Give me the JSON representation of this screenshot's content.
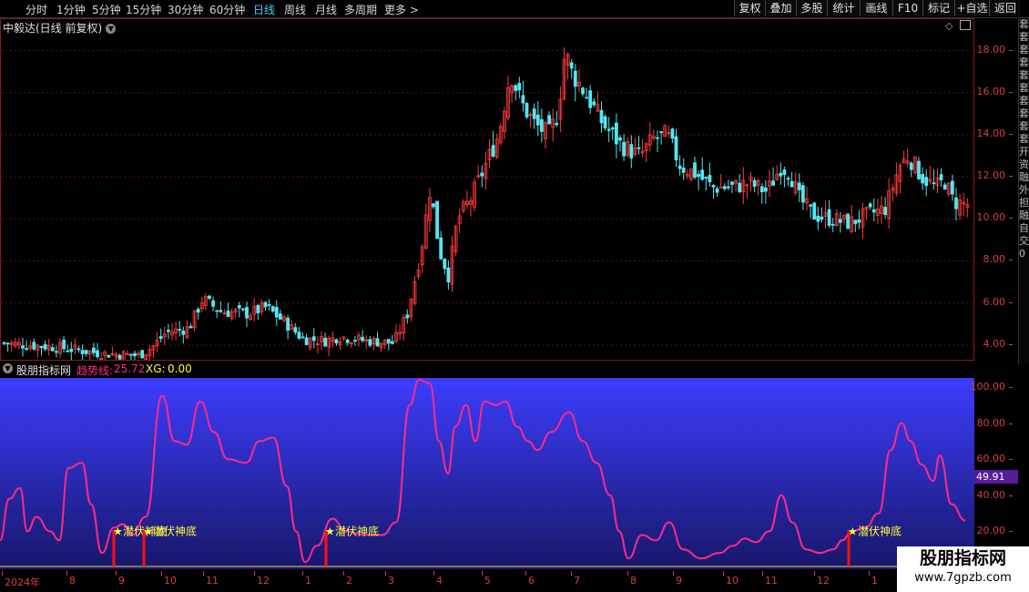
{
  "toolbar": {
    "tabs": [
      "分时",
      "1分钟",
      "5分钟",
      "15分钟",
      "30分钟",
      "60分钟",
      "日线",
      "周线",
      "月线",
      "多周期",
      "更多 >"
    ],
    "active_tab": "日线",
    "buttons": [
      "复权",
      "叠加",
      "多股",
      "统计",
      "画线",
      "F10",
      "标记",
      "+自选",
      "返回"
    ]
  },
  "stock": {
    "title": "中毅达(日线 前复权)"
  },
  "indicator": {
    "name": "股朋指标网",
    "trend_label": "趋势线:",
    "trend_value": "25.72",
    "xg_label": "XG:",
    "xg_value": "0.00",
    "current_value": "49.91",
    "signal_text": "潜伏神底"
  },
  "side_text": "套 套 套 套 套 套 套 套 套 套 开 资 融 外 担 融 自 交 0",
  "watermark": {
    "line1": "股朋指标网",
    "line2": "www.7gpzb.com"
  },
  "colors": {
    "up": "#ff3b3b",
    "down": "#54e6f0",
    "trend": "#ff2a88",
    "panel_top": "#3d3dff",
    "panel_bottom": "#17176a"
  },
  "chart_data": [
    {
      "type": "candlestick",
      "price_ticks": [
        "18.00",
        "16.00",
        "14.00",
        "12.00",
        "10.00",
        "8.00",
        "6.00",
        "4.00"
      ],
      "ylim": [
        3.3,
        19.5
      ],
      "close_points": [
        [
          0,
          4.1
        ],
        [
          60,
          3.9
        ],
        [
          110,
          3.6
        ],
        [
          150,
          3.5
        ],
        [
          165,
          3.9
        ],
        [
          180,
          4.6
        ],
        [
          205,
          4.8
        ],
        [
          220,
          6.2
        ],
        [
          240,
          5.6
        ],
        [
          270,
          5.5
        ],
        [
          290,
          5.8
        ],
        [
          310,
          5.1
        ],
        [
          330,
          4.3
        ],
        [
          355,
          4.2
        ],
        [
          370,
          4.4
        ],
        [
          400,
          4.2
        ],
        [
          430,
          4.1
        ],
        [
          445,
          5.5
        ],
        [
          460,
          8.5
        ],
        [
          470,
          11.5
        ],
        [
          480,
          8.5
        ],
        [
          490,
          7.3
        ],
        [
          500,
          10.0
        ],
        [
          515,
          11.0
        ],
        [
          530,
          12.5
        ],
        [
          545,
          14.0
        ],
        [
          558,
          17.0
        ],
        [
          570,
          15.5
        ],
        [
          585,
          14.5
        ],
        [
          600,
          14.0
        ],
        [
          610,
          15.0
        ],
        [
          618,
          18.0
        ],
        [
          625,
          17.0
        ],
        [
          640,
          16.0
        ],
        [
          660,
          14.5
        ],
        [
          680,
          13.5
        ],
        [
          700,
          13.0
        ],
        [
          715,
          13.8
        ],
        [
          730,
          14.0
        ],
        [
          745,
          12.5
        ],
        [
          760,
          12.2
        ],
        [
          780,
          11.5
        ],
        [
          800,
          11.5
        ],
        [
          820,
          11.7
        ],
        [
          840,
          11.3
        ],
        [
          855,
          12.5
        ],
        [
          865,
          12.2
        ],
        [
          875,
          11.0
        ],
        [
          890,
          10.2
        ],
        [
          910,
          10.0
        ],
        [
          930,
          9.8
        ],
        [
          950,
          10.2
        ],
        [
          970,
          10.5
        ],
        [
          985,
          12.5
        ],
        [
          995,
          13.0
        ],
        [
          1010,
          12.0
        ],
        [
          1025,
          11.5
        ],
        [
          1035,
          11.8
        ],
        [
          1045,
          10.8
        ],
        [
          1060,
          10.7
        ]
      ]
    },
    {
      "type": "line",
      "name": "趋势线",
      "ticks": [
        "100.00",
        "80.00",
        "60.00",
        "40.00",
        "20.00"
      ],
      "ylim": [
        0,
        105
      ],
      "points": [
        [
          0,
          15
        ],
        [
          10,
          38
        ],
        [
          22,
          44
        ],
        [
          30,
          20
        ],
        [
          40,
          28
        ],
        [
          55,
          20
        ],
        [
          65,
          15
        ],
        [
          75,
          55
        ],
        [
          90,
          58
        ],
        [
          100,
          35
        ],
        [
          112,
          8
        ],
        [
          125,
          22
        ],
        [
          135,
          24
        ],
        [
          145,
          18
        ],
        [
          160,
          28
        ],
        [
          178,
          95
        ],
        [
          192,
          70
        ],
        [
          205,
          68
        ],
        [
          220,
          92
        ],
        [
          235,
          75
        ],
        [
          250,
          60
        ],
        [
          270,
          58
        ],
        [
          285,
          70
        ],
        [
          300,
          72
        ],
        [
          315,
          45
        ],
        [
          325,
          20
        ],
        [
          335,
          3
        ],
        [
          348,
          12
        ],
        [
          365,
          27
        ],
        [
          380,
          20
        ],
        [
          400,
          18
        ],
        [
          420,
          18
        ],
        [
          435,
          25
        ],
        [
          450,
          90
        ],
        [
          460,
          104
        ],
        [
          472,
          102
        ],
        [
          482,
          70
        ],
        [
          492,
          52
        ],
        [
          500,
          78
        ],
        [
          512,
          90
        ],
        [
          522,
          70
        ],
        [
          532,
          92
        ],
        [
          545,
          90
        ],
        [
          555,
          92
        ],
        [
          568,
          78
        ],
        [
          580,
          70
        ],
        [
          590,
          65
        ],
        [
          605,
          75
        ],
        [
          625,
          86
        ],
        [
          640,
          70
        ],
        [
          655,
          58
        ],
        [
          670,
          40
        ],
        [
          680,
          20
        ],
        [
          690,
          5
        ],
        [
          705,
          18
        ],
        [
          720,
          15
        ],
        [
          735,
          25
        ],
        [
          750,
          10
        ],
        [
          770,
          5
        ],
        [
          790,
          8
        ],
        [
          805,
          12
        ],
        [
          818,
          16
        ],
        [
          830,
          14
        ],
        [
          845,
          20
        ],
        [
          858,
          40
        ],
        [
          870,
          25
        ],
        [
          885,
          10
        ],
        [
          900,
          8
        ],
        [
          915,
          10
        ],
        [
          925,
          15
        ],
        [
          935,
          20
        ],
        [
          950,
          22
        ],
        [
          965,
          30
        ],
        [
          978,
          65
        ],
        [
          990,
          80
        ],
        [
          1000,
          70
        ],
        [
          1012,
          57
        ],
        [
          1025,
          48
        ],
        [
          1032,
          62
        ],
        [
          1045,
          35
        ],
        [
          1060,
          26
        ]
      ],
      "current": 25.72
    }
  ],
  "time_axis": {
    "months": [
      "2024年",
      "8",
      "9",
      "10",
      "11",
      "12",
      "1",
      "2",
      "3",
      "4",
      "5",
      "6",
      "7",
      "8",
      "9",
      "10",
      "11",
      "12",
      "1"
    ]
  }
}
